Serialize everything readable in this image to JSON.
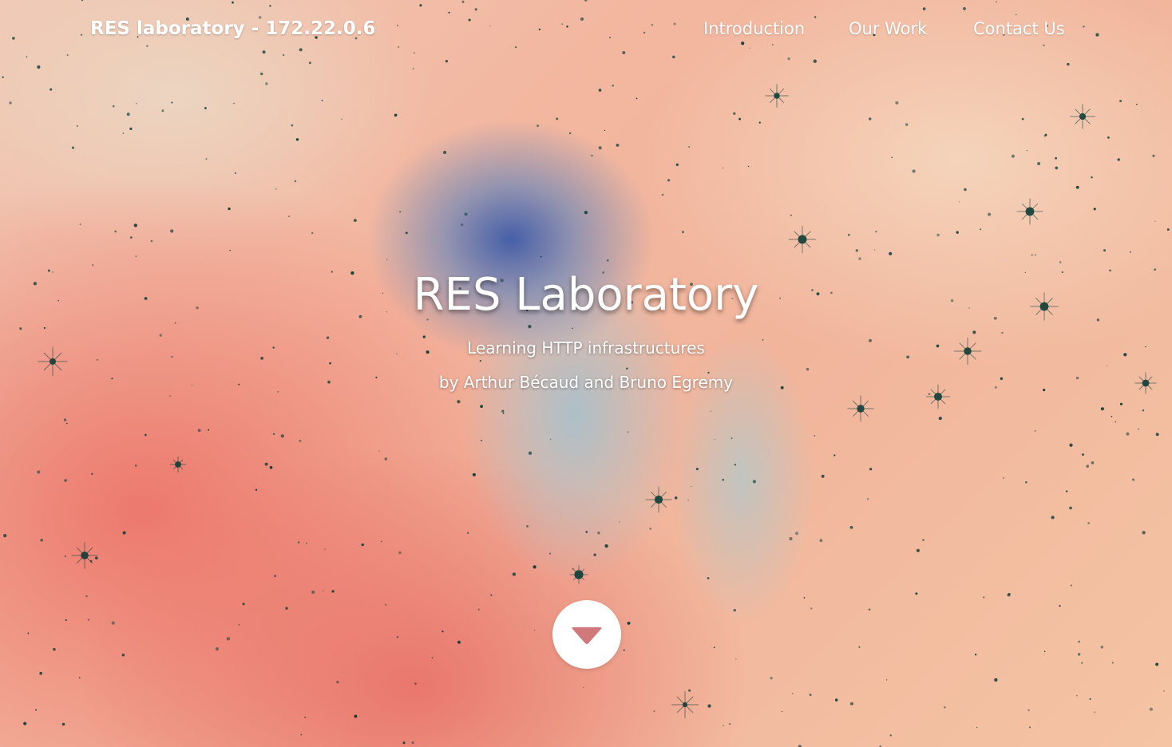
{
  "navbar": {
    "brand": "RES laboratory - 172.22.0.6",
    "links": [
      {
        "label": "Introduction"
      },
      {
        "label": "Our Work"
      },
      {
        "label": "Contact Us"
      }
    ]
  },
  "hero": {
    "title": "RES Laboratory",
    "subtitle": "Learning HTTP infrastructures",
    "authors": "by Arthur Bécaud and Bruno Egremy"
  },
  "scroll_button": {
    "icon": "caret-down-icon"
  },
  "colors": {
    "text": "#ffffff",
    "caret": "#d0787a",
    "button_bg": "#ffffff",
    "star": "#0b3b36"
  }
}
